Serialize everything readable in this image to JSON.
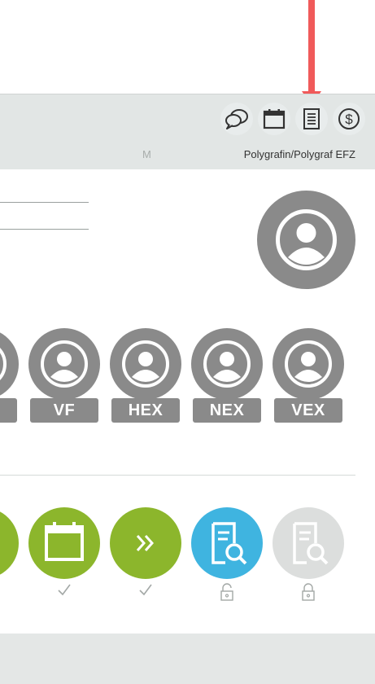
{
  "header": {
    "m_label": "M",
    "user_label": "Polygrafin/Polygraf EFZ",
    "icons": [
      "chat-icon",
      "calendar-icon",
      "document-icon",
      "dollar-icon"
    ]
  },
  "roles": [
    {
      "tag": ""
    },
    {
      "tag": "VF"
    },
    {
      "tag": "HEX"
    },
    {
      "tag": "NEX"
    },
    {
      "tag": "VEX"
    }
  ],
  "steps": [
    {
      "icon": "generic",
      "status": "none",
      "color": "#8cb62c"
    },
    {
      "icon": "calendar-icon",
      "status": "check",
      "color": "#8cb62c"
    },
    {
      "icon": "forward-icon",
      "status": "check",
      "color": "#8cb62c"
    },
    {
      "icon": "document-search-icon",
      "status": "lock",
      "color": "#3fb4e0"
    },
    {
      "icon": "document-search-icon",
      "status": "lock",
      "color": "#dcdedd"
    }
  ],
  "colors": {
    "accent_green": "#8cb62c",
    "accent_blue": "#3fb4e0",
    "avatar_gray": "#8a8a8a",
    "arrow_red": "#f05a5a"
  }
}
